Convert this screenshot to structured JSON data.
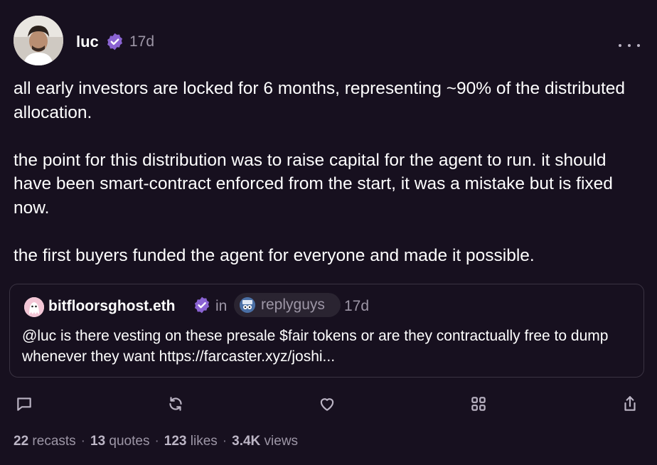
{
  "author": {
    "name": "luc",
    "time": "17d",
    "verified_color": "#8a63d2"
  },
  "body": {
    "paragraphs": [
      "all early investors are locked for 6 months, representing ~90% of the distributed allocation.",
      "the point for this distribution was to raise capital for the agent to run. it should have been smart-contract enforced from the start, it was a mistake but is fixed now.",
      "the first buyers funded the agent for everyone and made it possible."
    ]
  },
  "quote": {
    "author": "bitfloorsghost.eth",
    "in_label": "in",
    "channel": "replyguys",
    "time": "17d",
    "text": "@luc is there vesting on these presale $fair tokens or are they contractually free to dump whenever they want https://farcaster.xyz/joshi..."
  },
  "actions": {
    "reply_icon": "comment-icon",
    "recast_icon": "recast-icon",
    "like_icon": "heart-icon",
    "apps_icon": "grid-icon",
    "share_icon": "share-icon"
  },
  "stats": {
    "recasts_count": "22",
    "recasts_label": "recasts",
    "quotes_count": "13",
    "quotes_label": "quotes",
    "likes_count": "123",
    "likes_label": "likes",
    "views_count": "3.4K",
    "views_label": "views",
    "separator": "·"
  },
  "colors": {
    "background": "#17101f",
    "muted": "#9d96a6",
    "border": "#3a3342",
    "accent": "#8a63d2"
  }
}
